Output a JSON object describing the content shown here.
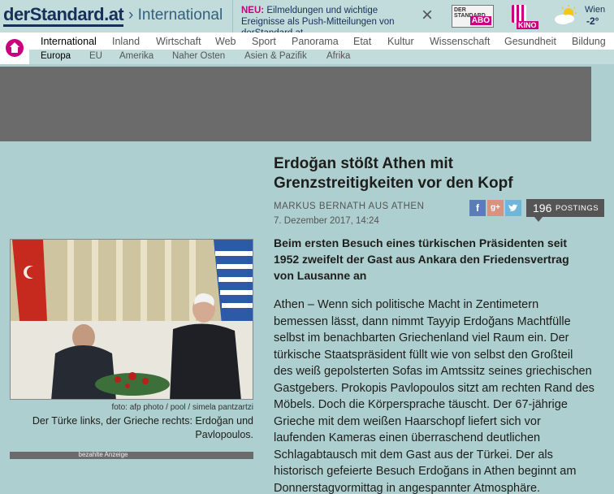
{
  "header": {
    "logo": "derStandard.at",
    "section": "› International",
    "push": {
      "new_label": "NEU:",
      "text": " Eilmeldungen und wichtige Ereignisse als Push-Mitteilungen von derStandard.at",
      "close_icon": "close-icon"
    },
    "abo": {
      "small": "DER STANDARD",
      "big": "ABO"
    },
    "kino": {
      "label": "KINO"
    },
    "weather": {
      "city": "Wien",
      "temp": "-2°",
      "icon": "sun-cloud-icon"
    }
  },
  "nav_primary": [
    {
      "label": "International",
      "active": true
    },
    {
      "label": "Inland"
    },
    {
      "label": "Wirtschaft"
    },
    {
      "label": "Web"
    },
    {
      "label": "Sport"
    },
    {
      "label": "Panorama"
    },
    {
      "label": "Etat"
    },
    {
      "label": "Kultur"
    },
    {
      "label": "Wissenschaft"
    },
    {
      "label": "Gesundheit"
    },
    {
      "label": "Bildung"
    }
  ],
  "nav_secondary": [
    {
      "label": "Europa",
      "active": true
    },
    {
      "label": "EU"
    },
    {
      "label": "Amerika"
    },
    {
      "label": "Naher Osten"
    },
    {
      "label": "Asien & Pazifik"
    },
    {
      "label": "Afrika"
    }
  ],
  "article": {
    "headline": "Erdoğan stößt Athen mit Grenzstreitigkeiten vor den Kopf",
    "author": "Markus Bernath aus Athen",
    "date": "7. Dezember 2017, 14:24",
    "share": {
      "fb": "f",
      "gplus": "g+",
      "twitter": "t"
    },
    "postings_count": "196",
    "postings_label": "POSTINGS",
    "lead": "Beim ersten Besuch eines türkischen Präsidenten seit 1952 zweifelt der Gast aus Ankara den Friedensvertrag von Lausanne an",
    "body": "Athen – Wenn sich politische Macht in Zentimetern bemessen lässt, dann nimmt Tayyip Erdoğans Machtfülle selbst im benachbarten Griechenland viel Raum ein. Der türkische Staatspräsident füllt wie von selbst den Großteil des weiß gepolsterten Sofas im Amtssitz seines griechischen Gastgebers. Prokopis Pavlopoulos sitzt am rechten Rand des Möbels. Doch die Körpersprache täuscht. Der 67-jährige Grieche mit dem weißen Haarschopf liefert sich vor laufenden Kameras einen überraschend deutlichen Schlagabtausch mit dem Gast aus der Türkei. Der als historisch gefeierte Besuch Erdoğans in Athen beginnt am Donnerstagvormittag in angespannter Atmosphäre."
  },
  "photo": {
    "credit": "foto: afp photo / pool / simela pantzartzi",
    "caption": "Der Türke links, der Grieche rechts: Erdoğan und Pavlopoulos."
  },
  "paid_ad_label": "bezahlte Anzeige",
  "colors": {
    "background": "#aecfcf",
    "brand_navy": "#16305a",
    "accent_magenta": "#c8007e",
    "ad_gray": "#6b6b6b"
  }
}
